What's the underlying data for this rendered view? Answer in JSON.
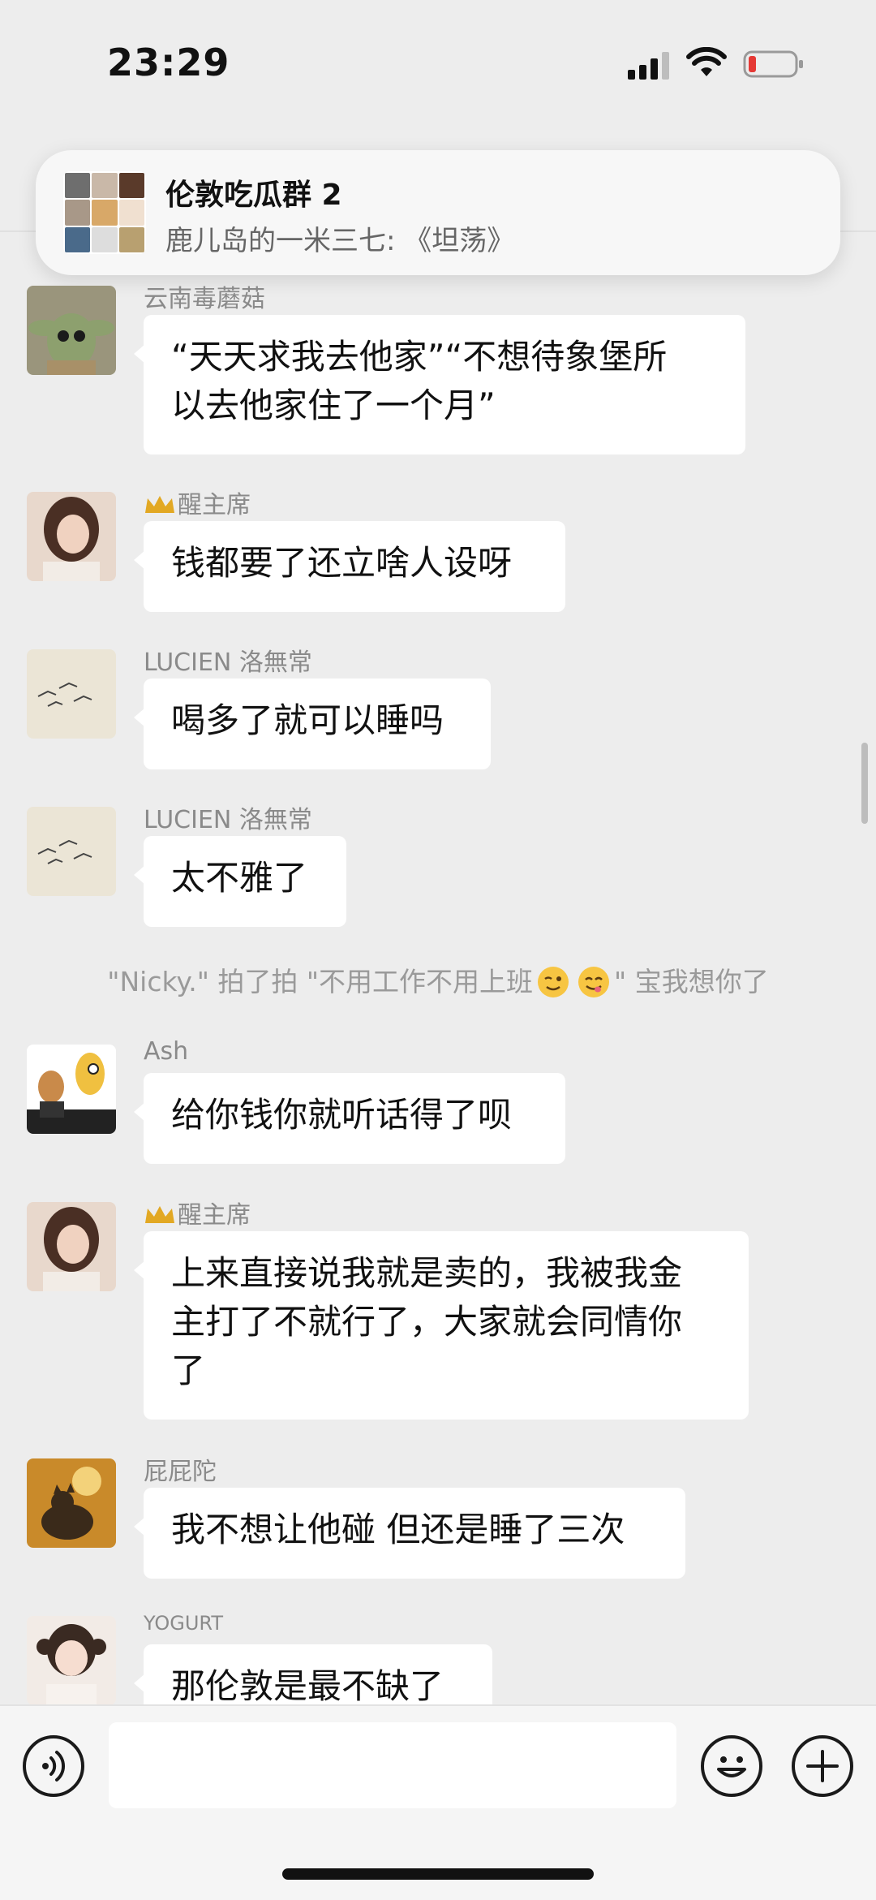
{
  "status_bar": {
    "time": "23:29"
  },
  "notification": {
    "group_name": "伦敦吃瓜群 2",
    "preview": "鹿儿岛的一米三七: 《坦荡》",
    "avatar_icon": "group-avatar-grid-icon"
  },
  "messages": [
    {
      "sender": "云南毒蘑菇",
      "lines": [
        "“天天求我去他家”“不想待象堡所",
        "以去他家住了一个月”"
      ],
      "avatar_color": "#8b8a6f"
    },
    {
      "sender": "醒主席",
      "has_crown": true,
      "lines": [
        "钱都要了还立啥人设呀"
      ],
      "avatar_color": "#c9a48f"
    },
    {
      "sender": "LUCIEN 洛無常",
      "lines": [
        "喝多了就可以睡吗"
      ],
      "avatar_color": "#e8e2d4"
    },
    {
      "sender": "LUCIEN 洛無常",
      "lines": [
        "太不雅了"
      ],
      "avatar_color": "#e8e2d4"
    },
    {
      "sender": "Ash",
      "lines": [
        "给你钱你就听话得了呗"
      ],
      "avatar_color": "#f0c040"
    },
    {
      "sender": "醒主席",
      "has_crown": true,
      "lines": [
        "上来直接说我就是卖的，我被我金",
        "主打了不就行了，大家就会同情你",
        "了"
      ],
      "avatar_color": "#c9a48f"
    },
    {
      "sender": "屁屁陀",
      "lines": [
        "我不想让他碰 但还是睡了三次"
      ],
      "avatar_color": "#b07a28"
    },
    {
      "sender": "YOGURT",
      "lines": [
        "那伦敦是最不缺了"
      ],
      "avatar_color": "#e7d4c8"
    }
  ],
  "system_message": {
    "before": "\"Nicky.\" 拍了拍 \"不用工作不用上班",
    "after": "\" 宝我想你了",
    "emojis": [
      "winking-face-emoji",
      "savoring-food-emoji"
    ]
  },
  "input_bar": {
    "placeholder": "",
    "voice_icon": "voice-icon",
    "emoji_icon": "smiley-icon",
    "more_icon": "plus-icon"
  },
  "colors": {
    "background": "#ededed",
    "bubble": "#ffffff",
    "sender_text": "#8a8a8a",
    "system_text": "#9a9a9a"
  }
}
